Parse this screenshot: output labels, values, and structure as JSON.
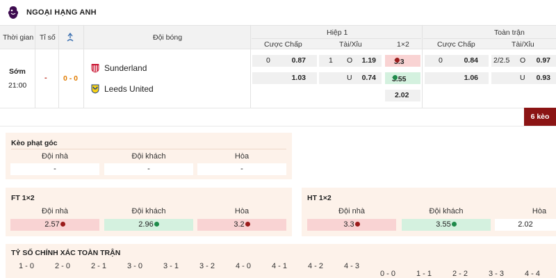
{
  "league": {
    "title": "NGOẠI HẠNG ANH",
    "icon": "premier-league-logo"
  },
  "header": {
    "time": "Thời gian",
    "score": "Tỉ số",
    "corner_icon": "stats-icon",
    "teams": "Đội bóng",
    "half1": "Hiệp 1",
    "fulltime": "Toàn trận",
    "handicap": "Cược Chấp",
    "overunder": "Tài/Xỉu",
    "onextwo": "1×2",
    "handicap_ft": "Cược Chấp",
    "overunder_ft": "Tài/Xỉu"
  },
  "match": {
    "status": "Sớm",
    "time": "21:00",
    "dash": "-",
    "score": "0 - 0",
    "home": "Sunderland",
    "away": "Leeds United",
    "h1_handicap": {
      "line": "0",
      "home": "0.87",
      "away": "1.03"
    },
    "h1_ou": {
      "line": "1",
      "o": "O",
      "home": "1.19",
      "u": "U",
      "away": "0.74"
    },
    "h1_1x2": {
      "home": "3.3",
      "away": "3.55",
      "draw": "2.02"
    },
    "ft_handicap": {
      "line": "0",
      "home": "0.84",
      "away": "1.06"
    },
    "ft_ou": {
      "line": "2/2.5",
      "o": "O",
      "home": "0.97",
      "u": "U",
      "away": "0.93"
    }
  },
  "more_button": "6 kèo",
  "corner_panel": {
    "title": "Kèo phạt góc",
    "cols": [
      "Đội nhà",
      "Đội khách",
      "Hòa"
    ],
    "vals": [
      "-",
      "-",
      "-"
    ]
  },
  "ft_panel": {
    "title": "FT 1×2",
    "cols": [
      "Đội nhà",
      "Đội khách",
      "Hòa"
    ],
    "vals": [
      "2.57",
      "2.96",
      "3.2"
    ]
  },
  "ht_panel": {
    "title": "HT 1×2",
    "cols": [
      "Đội nhà",
      "Đội khách",
      "Hòa"
    ],
    "vals": [
      "3.3",
      "3.55",
      "2.02"
    ]
  },
  "correct_score": {
    "title": "TỶ SỐ CHÍNH XÁC TOÀN TRẬN",
    "home_wins": [
      "1 - 0",
      "2 - 0",
      "2 - 1",
      "3 - 0",
      "3 - 1",
      "3 - 2",
      "4 - 0",
      "4 - 1",
      "4 - 2",
      "4 - 3"
    ],
    "draws": [
      "0 - 0",
      "1 - 1",
      "2 - 2",
      "3 - 3",
      "4 - 4"
    ]
  },
  "colors": {
    "accent": "#8b1414",
    "up": "#9b1b1b",
    "down": "#1e8a4a",
    "panel": "#fdf2ea"
  }
}
